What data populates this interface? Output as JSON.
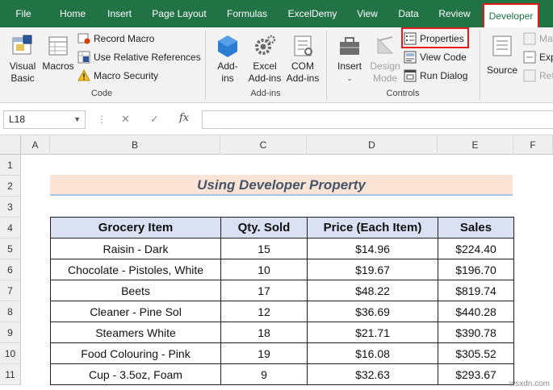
{
  "ribbon_tabs": [
    "File",
    "Home",
    "Insert",
    "Page Layout",
    "Formulas",
    "ExcelDemy",
    "View",
    "Data",
    "Review",
    "Developer"
  ],
  "active_tab": "Developer",
  "code_group": {
    "label": "Code",
    "visual_basic": [
      "Visual",
      "Basic"
    ],
    "macros": "Macros",
    "record_macro": "Record Macro",
    "relative_refs": "Use Relative References",
    "macro_security": "Macro Security"
  },
  "addins_group": {
    "label": "Add-ins",
    "addins": [
      "Add-",
      "ins"
    ],
    "excel_addins": [
      "Excel",
      "Add-ins"
    ],
    "com_addins": [
      "COM",
      "Add-ins"
    ]
  },
  "controls_group": {
    "label": "Controls",
    "insert": "Insert",
    "design_mode": [
      "Design",
      "Mode"
    ],
    "properties": "Properties",
    "view_code": "View Code",
    "run_dialog": "Run Dialog"
  },
  "xml_group": {
    "source": "Source",
    "map": "Map",
    "expand": "Exp",
    "refresh": "Refr"
  },
  "formula_bar": {
    "name_box": "L18",
    "fx": "fx",
    "cancel": "✕",
    "enter": "✓"
  },
  "columns": [
    "A",
    "B",
    "C",
    "D",
    "E",
    "F"
  ],
  "rows": [
    "1",
    "2",
    "3",
    "4",
    "5",
    "6",
    "7",
    "8",
    "9",
    "10",
    "11"
  ],
  "sheet_title": "Using Developer Property",
  "table": {
    "headers": [
      "Grocery Item",
      "Qty. Sold",
      "Price (Each Item)",
      "Sales"
    ],
    "rows": [
      [
        "Raisin - Dark",
        "15",
        "$14.96",
        "$224.40"
      ],
      [
        "Chocolate - Pistoles, White",
        "10",
        "$19.67",
        "$196.70"
      ],
      [
        "Beets",
        "17",
        "$48.22",
        "$819.74"
      ],
      [
        "Cleaner - Pine Sol",
        "12",
        "$36.69",
        "$440.28"
      ],
      [
        "Steamers White",
        "18",
        "$21.71",
        "$390.78"
      ],
      [
        "Food Colouring - Pink",
        "19",
        "$16.08",
        "$305.52"
      ],
      [
        "Cup - 3.5oz, Foam",
        "9",
        "$32.63",
        "$293.67"
      ]
    ]
  },
  "watermark": "wsxdn.com",
  "colors": {
    "excel_green": "#217346",
    "highlight_red": "#e21b1b",
    "title_fill": "#fbe4d5",
    "header_fill": "#d9e1f2"
  }
}
